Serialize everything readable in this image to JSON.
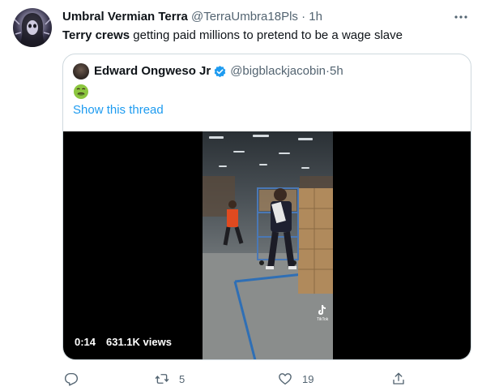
{
  "tweet": {
    "author_name": "Umbral Vermian Terra",
    "author_handle": "@TerraUmbra18Pls",
    "separator": "·",
    "time": "1h",
    "text_bold": "Terry crews",
    "text_rest": " getting paid millions to pretend to be a wage slave",
    "avatar_icon": "hooded-figure-avatar",
    "more_icon": "more-icon"
  },
  "quote": {
    "author_name": "Edward Ongweso Jr",
    "author_handle": "@bigblackjacobin",
    "separator": "·",
    "time": "5h",
    "emoji": "nauseated-face-emoji",
    "show_thread": "Show this thread",
    "verified_color": "#1d9bf0"
  },
  "video": {
    "elapsed": "0:14",
    "views": "631.1K views",
    "watermark": "TikTok"
  },
  "actions": {
    "reply_icon": "reply-icon",
    "retweet_icon": "retweet-icon",
    "retweet_count": "5",
    "like_icon": "like-icon",
    "like_count": "19",
    "share_icon": "share-icon"
  },
  "colors": {
    "accent": "#1d9bf0",
    "secondary_text": "#536471",
    "border": "#cfd9de"
  }
}
